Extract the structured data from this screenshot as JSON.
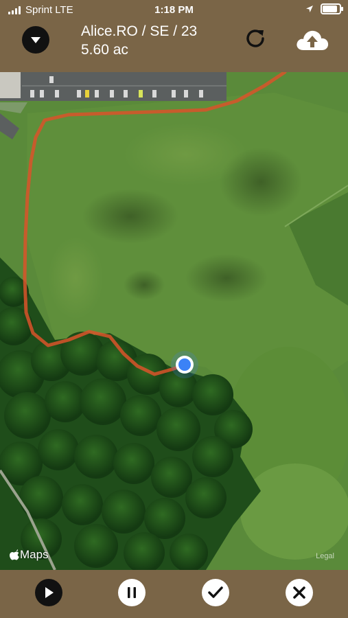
{
  "status_bar": {
    "carrier": "Sprint",
    "network": "LTE",
    "time": "1:18 PM",
    "location_icon": "location-arrow-icon",
    "battery_level": 0.9
  },
  "header": {
    "title": "Alice.RO / SE / 23",
    "area": "5.60 ac",
    "dropdown_icon": "chevron-down-icon",
    "refresh_icon": "refresh-icon",
    "upload_icon": "cloud-upload-icon"
  },
  "map": {
    "attribution": "Maps",
    "legal": "Legal",
    "track_color": "#d9542a",
    "location_color": "#3b82f6",
    "view": "satellite"
  },
  "toolbar": {
    "play_icon": "play-icon",
    "pause_icon": "pause-icon",
    "check_icon": "check-icon",
    "cancel_icon": "close-icon"
  },
  "colors": {
    "bar_background": "#7a6547",
    "text": "#ffffff"
  }
}
